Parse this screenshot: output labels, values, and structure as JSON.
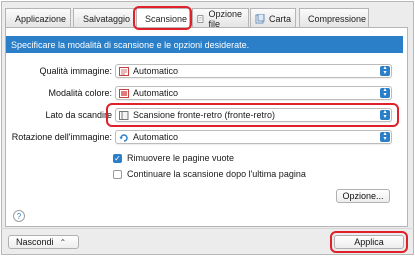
{
  "tabs": [
    {
      "label": "Applicazione",
      "icon": "pen-icon"
    },
    {
      "label": "Salvataggio",
      "icon": "save-icon"
    },
    {
      "label": "Scansione",
      "icon": "scan-grid-icon"
    },
    {
      "label": "Opzione file",
      "icon": "file-option-icon"
    },
    {
      "label": "Carta",
      "icon": "paper-icon"
    },
    {
      "label": "Compressione",
      "icon": "compression-icon"
    }
  ],
  "active_tab": "Scansione",
  "header": {
    "text": "Specificare la modalità di scansione e le opzioni desiderate."
  },
  "settings": {
    "quality": {
      "label": "Qualità immagine:",
      "value": "Automatico"
    },
    "color": {
      "label": "Modalità colore:",
      "value": "Automatico"
    },
    "side": {
      "label": "Lato da scandire",
      "value": "Scansione fronte-retro (fronte-retro)"
    },
    "rotation": {
      "label": "Rotazione dell'immagine:",
      "value": "Automatico"
    }
  },
  "options": {
    "remove_blank": {
      "label": "Rimuovere le pagine vuote",
      "checked": true
    },
    "continue_scan": {
      "label": "Continuare la scansione dopo l'ultima pagina",
      "checked": false
    }
  },
  "buttons": {
    "option": "Opzione...",
    "hide": "Nascondi",
    "apply": "Applica",
    "help": "?"
  },
  "colors": {
    "accent": "#2a7fc8",
    "highlight": "#e0202a"
  }
}
